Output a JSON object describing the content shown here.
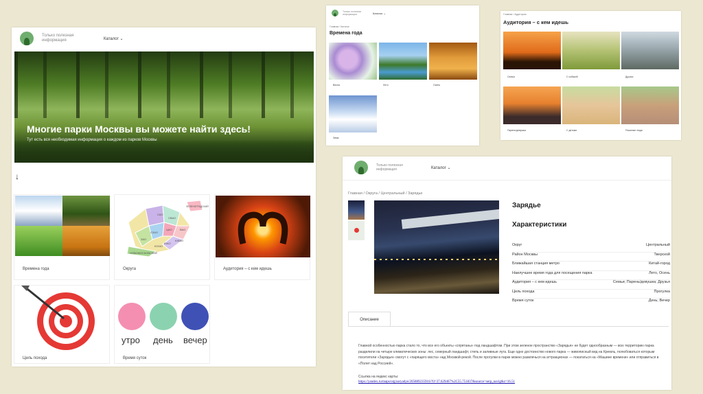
{
  "main": {
    "tagline": "Только полезная информация",
    "catalog": "Каталог ⌄",
    "hero_title": "Многие парки Москвы вы можете найти здесь!",
    "hero_sub": "Тут есть вся необходимая информация о каждом из парков Москвы",
    "arrow": "↓",
    "cards": [
      {
        "label": "Времена года"
      },
      {
        "label": "Округа"
      },
      {
        "label": "Аудитория – с кем идешь"
      },
      {
        "label": "Цель похода"
      },
      {
        "label": "Время суток"
      }
    ],
    "district_labels": [
      "ЗЕЛЕНОГРАДСКИЙ",
      "ВАО",
      "ЮВАО",
      "ЮАО",
      "ЮЗАО",
      "ЗАО",
      "СЗАО",
      "САО",
      "СВАО",
      "ЦАО",
      "НОВОМОСКОВСКИЙ"
    ],
    "time_words": [
      "утро",
      "день",
      "вечер"
    ]
  },
  "seasons": {
    "tagline": "Только полезная информация",
    "catalog": "Каталог ⌄",
    "crumb": "Главная / Каталог",
    "title": "Времена года",
    "items": [
      {
        "label": "Весна"
      },
      {
        "label": "Лето"
      },
      {
        "label": "Осень"
      },
      {
        "label": "Зима"
      }
    ]
  },
  "audience": {
    "crumb": "Главная / Аудитория",
    "title": "Аудитория – с кем идешь",
    "items": [
      {
        "label": "Семья"
      },
      {
        "label": "С собакой"
      },
      {
        "label": "Друзья"
      },
      {
        "label": "Парень/девушка"
      },
      {
        "label": "С детьми"
      },
      {
        "label": "Пожилые люди"
      }
    ]
  },
  "detail": {
    "tagline": "Только полезная информация",
    "catalog": "Каталог ⌄",
    "crumb": "Главная / Округа / Центральный / Зарядье",
    "title": "Зарядье",
    "subtitle": "Характеристики",
    "specs": [
      {
        "k": "Округ",
        "v": "Центральный"
      },
      {
        "k": "Район Москвы",
        "v": "Тверской"
      },
      {
        "k": "Ближайшая станция метро",
        "v": "Китай-город"
      },
      {
        "k": "Наилучшее время года для посещения парка",
        "v": "Лето, Осень"
      },
      {
        "k": "Аудитория – с кем идешь",
        "v": "Семьи; Парень/девушка; Друзья"
      },
      {
        "k": "Цель похода",
        "v": "Прогулка"
      },
      {
        "k": "Время суток",
        "v": "День; Вечер"
      }
    ],
    "tab": "Описание",
    "description": "Главной особенностью парка стало то, что все его объекты «спрятаны» под ландшафтом. При этом зеленое пространство «Зарядья» не будет однообразным — всю территорию парка разделили на четыре климатических зоны: лес, северный ландшафт, степь и заливные луга. Еще одно достоинство нового парка — живописный вид на Кремль, полюбоваться которым посетители «Зарядья» смогут с «парящего моста» над Москвой-рекой. После прогулки в парке можно развлечься на аттракционах — покататься на «Машине времени» или отправиться в «Полет над Россией».",
    "map_label": "Ссылка на яндекс карты:",
    "map_link": "https://yandex.ru/maps/org/zaryadye/205889235916/?ll=37.629467%2C55.751837&source=serp_navig&z=16.51"
  }
}
